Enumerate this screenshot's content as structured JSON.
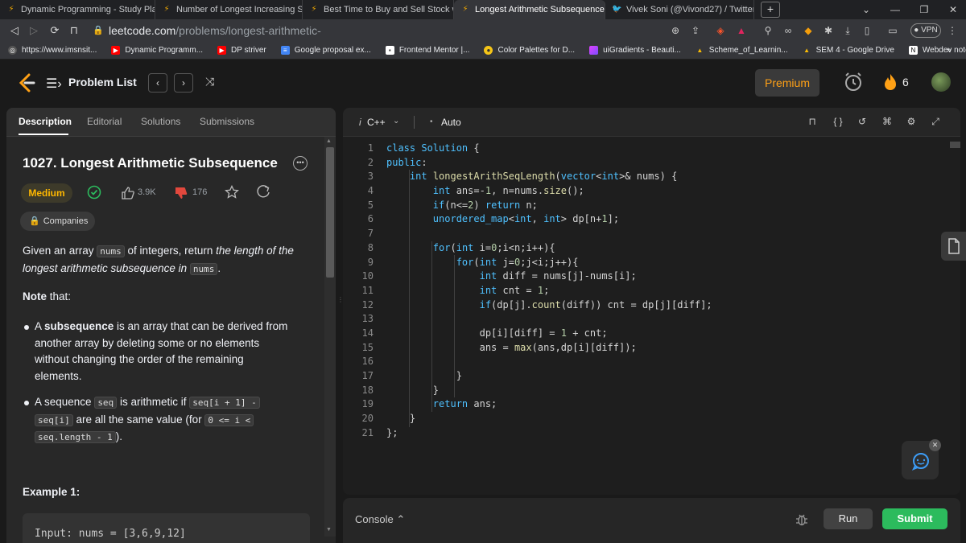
{
  "browser": {
    "tabs": [
      {
        "title": "Dynamic Programming - Study Plan -",
        "active": false
      },
      {
        "title": "Number of Longest Increasing Subseq",
        "active": false
      },
      {
        "title": "Best Time to Buy and Sell Stock with T",
        "active": false
      },
      {
        "title": "Longest Arithmetic Subsequence",
        "active": true
      },
      {
        "title": "Vivek Soni (@Vivond27) / Twitter",
        "active": false
      }
    ],
    "url_host": "leetcode.com",
    "url_path": "/problems/longest-arithmetic-subsequence/description/",
    "vpn_label": "VPN",
    "bookmarks": [
      {
        "label": "https://www.imsnsit...",
        "icon": "globe-icon"
      },
      {
        "label": "Dynamic Programm...",
        "icon": "youtube-icon"
      },
      {
        "label": "DP striver",
        "icon": "youtube-icon"
      },
      {
        "label": "Google proposal ex...",
        "icon": "docs-icon"
      },
      {
        "label": "Frontend Mentor |...",
        "icon": "fm-icon"
      },
      {
        "label": "Color Palettes for D...",
        "icon": "palette-icon"
      },
      {
        "label": "uiGradients - Beauti...",
        "icon": "gradient-icon"
      },
      {
        "label": "Scheme_of_Learnin...",
        "icon": "drive-icon"
      },
      {
        "label": "SEM 4 - Google Drive",
        "icon": "drive-icon"
      },
      {
        "label": "Webdev notebook",
        "icon": "notion-icon"
      }
    ],
    "bookmarks_more": "»"
  },
  "header": {
    "problem_list_label": "Problem List",
    "premium_label": "Premium",
    "streak_count": "6"
  },
  "left_tabs": [
    "Description",
    "Editorial",
    "Solutions",
    "Submissions"
  ],
  "problem": {
    "title": "1027. Longest Arithmetic Subsequence",
    "difficulty": "Medium",
    "likes": "3.9K",
    "dislikes": "176",
    "companies_label": "Companies",
    "desc_prefix": "Given an array ",
    "desc_code1": "nums",
    "desc_mid": " of integers, return ",
    "desc_em1": "the length of the",
    "desc_em2": "longest arithmetic subsequence in ",
    "desc_code2": "nums",
    "desc_end": ".",
    "note_bold": "Note",
    "note_rest": " that:",
    "bullet1_pre": "A ",
    "bullet1_bold": "subsequence",
    "bullet1_l1": " is an array that can be derived from",
    "bullet1_l2": "another array by deleting some or no elements",
    "bullet1_l3": "without changing the order of the remaining",
    "bullet1_l4": "elements.",
    "bullet2_pre": "A sequence ",
    "bullet2_code1": "seq",
    "bullet2_mid": " is arithmetic if ",
    "bullet2_code2": "seq[i + 1] -",
    "bullet2_code3": "seq[i]",
    "bullet2_mid2": " are all the same value (for ",
    "bullet2_code4": "0 <= i <",
    "bullet2_code5": "seq.length - 1",
    "bullet2_end": ").",
    "example_heading": "Example 1:",
    "example_input": "Input: nums = [3,6,9,12]"
  },
  "editor": {
    "language": "C++",
    "mode": "Auto",
    "line_numbers": [
      "1",
      "2",
      "3",
      "4",
      "5",
      "6",
      "7",
      "8",
      "9",
      "10",
      "11",
      "12",
      "13",
      "14",
      "15",
      "16",
      "17",
      "18",
      "19",
      "20",
      "21"
    ]
  },
  "console": {
    "console_label": "Console",
    "run_label": "Run",
    "submit_label": "Submit"
  },
  "colors": {
    "accent_orange": "#ffa116",
    "medium_yellow": "#ffb800",
    "submit_green": "#2cbb5d"
  }
}
